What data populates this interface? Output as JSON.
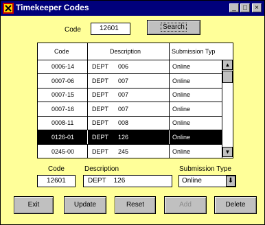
{
  "window": {
    "title": "Timekeeper Codes",
    "controls": {
      "minimize": "_",
      "maximize": "□",
      "close": "×"
    }
  },
  "search": {
    "code_label": "Code",
    "code_value": "12601",
    "search_label": "Search"
  },
  "table": {
    "columns": [
      "Code",
      "Description",
      "Submission Typ"
    ],
    "rows": [
      {
        "code": "0006-14",
        "dept": "DEPT",
        "num": "006",
        "type": "Online"
      },
      {
        "code": "0007-06",
        "dept": "DEPT",
        "num": "007",
        "type": "Online"
      },
      {
        "code": "0007-15",
        "dept": "DEPT",
        "num": "007",
        "type": "Online"
      },
      {
        "code": "0007-16",
        "dept": "DEPT",
        "num": "007",
        "type": "Online"
      },
      {
        "code": "0008-11",
        "dept": "DEPT",
        "num": "008",
        "type": "Online"
      },
      {
        "code": "0126-01",
        "dept": "DEPT",
        "num": "126",
        "type": "Online"
      },
      {
        "code": "0245-00",
        "dept": "DEPT",
        "num": "245",
        "type": "Online"
      }
    ],
    "selected_index": 5,
    "scroll_up": "▲",
    "scroll_down": "▼"
  },
  "detail": {
    "code_label": "Code",
    "code_value": "12601",
    "description_label": "Description",
    "description_value": "DEPT    126",
    "submission_label": "Submission Type",
    "submission_value": "Online",
    "dropdown_arrow": "⬇"
  },
  "buttons": {
    "exit": "Exit",
    "update": "Update",
    "reset": "Reset",
    "add": "Add",
    "delete": "Delete"
  },
  "colors": {
    "window_bg": "#ffff99",
    "titlebar": "#00007b",
    "selection": "#000000"
  }
}
